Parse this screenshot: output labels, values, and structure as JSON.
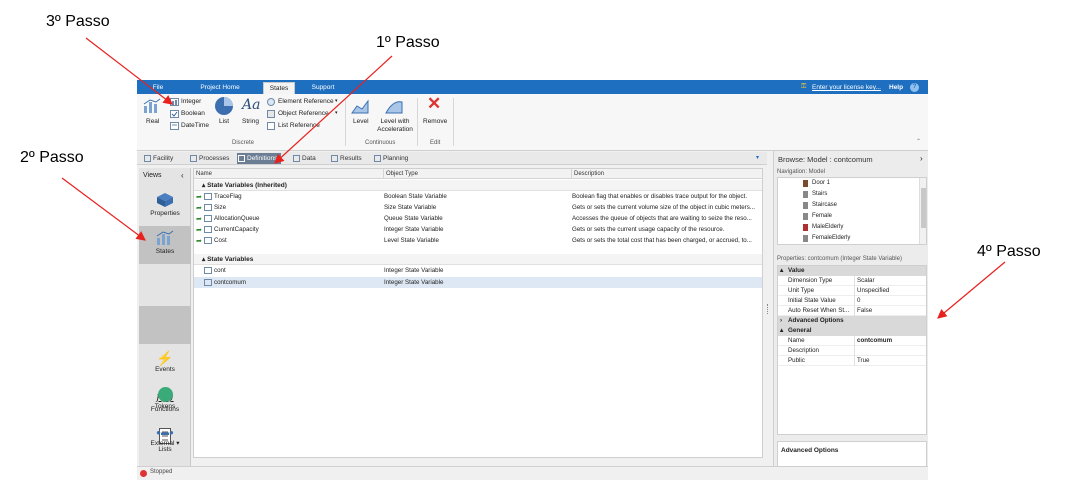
{
  "annotations": {
    "step3": "3º Passo",
    "step1": "1º Passo",
    "step2": "2º Passo",
    "step4": "4º Passo"
  },
  "ribbon_tabs": [
    "File",
    "Project Home",
    "States",
    "Support"
  ],
  "license_link": "Enter your license key...",
  "help": "Help",
  "ribbon": {
    "real": "Real",
    "integer": "Integer",
    "boolean": "Boolean",
    "datetime": "DateTime",
    "list": "List",
    "string": "String",
    "element_reference": "Element Reference",
    "object_reference": "Object Reference",
    "list_reference": "List Reference",
    "group_discrete": "Discrete",
    "level": "Level",
    "level_accel": "Level with Acceleration",
    "group_continuous": "Continuous",
    "remove": "Remove",
    "group_edit": "Edit"
  },
  "doc_tabs": [
    "Facility",
    "Processes",
    "Definitions",
    "Data",
    "Results",
    "Planning"
  ],
  "views": {
    "header": "Views",
    "items": [
      "Properties",
      "States",
      "Events",
      "Functions",
      "Lists",
      "Tokens",
      "External"
    ]
  },
  "grid": {
    "columns": [
      "Name",
      "Object Type",
      "Description"
    ],
    "section_inherited": "State Variables (Inherited)",
    "inherited_rows": [
      {
        "name": "TraceFlag",
        "type": "Boolean State Variable",
        "desc": "Boolean flag that enables or disables trace output for the object."
      },
      {
        "name": "Size",
        "type": "Size State Variable",
        "desc": "Gets or sets the current volume size of the object in cubic meters..."
      },
      {
        "name": "AllocationQueue",
        "type": "Queue State Variable",
        "desc": "Accesses the queue of objects that are waiting to seize the reso..."
      },
      {
        "name": "CurrentCapacity",
        "type": "Integer State Variable",
        "desc": "Gets or sets the current usage capacity of the resource."
      },
      {
        "name": "Cost",
        "type": "Level State Variable",
        "desc": "Gets or sets the total cost that has been charged, or accrued, to..."
      }
    ],
    "section_own": "State Variables",
    "own_rows": [
      {
        "name": "cont",
        "type": "Integer State Variable",
        "desc": ""
      },
      {
        "name": "contcomum",
        "type": "Integer State Variable",
        "desc": ""
      }
    ]
  },
  "right_panel": {
    "browse": "Browse: Model : contcomum",
    "navigation_label": "Navigation: Model",
    "nav_items": [
      "Door 1",
      "Stairs",
      "Staircase",
      "Female",
      "MaleElderly",
      "FemaleElderly"
    ],
    "properties_label": "Properties: contcomum (Integer State Variable)",
    "section_value": "Value",
    "value_props": [
      {
        "k": "Dimension Type",
        "v": "Scalar"
      },
      {
        "k": "Unit Type",
        "v": "Unspecified"
      },
      {
        "k": "Initial State Value",
        "v": "0"
      },
      {
        "k": "Auto Reset When St...",
        "v": "False"
      }
    ],
    "advanced": "Advanced Options",
    "section_general": "General",
    "general_props": [
      {
        "k": "Name",
        "v": "contcomum"
      },
      {
        "k": "Description",
        "v": ""
      },
      {
        "k": "Public",
        "v": "True"
      }
    ],
    "desc_title": "Advanced Options"
  },
  "status_text": "Stopped"
}
